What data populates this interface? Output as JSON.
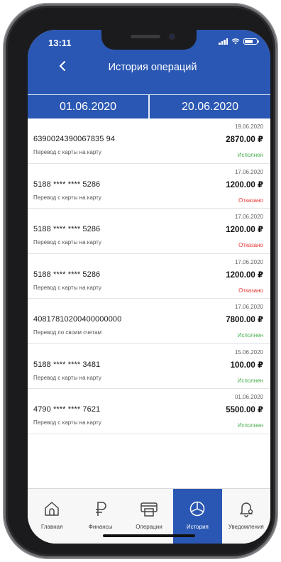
{
  "status_bar": {
    "time": "13:11"
  },
  "header": {
    "title": "История операций",
    "back_icon": "chevron-left-icon"
  },
  "period": {
    "from": "01.06.2020",
    "to": "20.06.2020"
  },
  "colors": {
    "primary": "#2a57b3",
    "success": "#4caf50",
    "declined": "#e53935"
  },
  "operations": [
    {
      "account": "6390024390067835 94",
      "description": "Перевод с карты на карту",
      "date": "19.06.2020",
      "amount": "2870.00 ₽",
      "status": "Исполнен",
      "status_kind": "success"
    },
    {
      "account": "5188 **** **** 5286",
      "description": "Перевод с карты на карту",
      "date": "17.06.2020",
      "amount": "1200.00 ₽",
      "status": "Отказано",
      "status_kind": "declined"
    },
    {
      "account": "5188 **** **** 5286",
      "description": "Перевод с карты на карту",
      "date": "17.06.2020",
      "amount": "1200.00 ₽",
      "status": "Отказано",
      "status_kind": "declined"
    },
    {
      "account": "5188 **** **** 5286",
      "description": "Перевод с карты на карту",
      "date": "17.06.2020",
      "amount": "1200.00 ₽",
      "status": "Отказано",
      "status_kind": "declined"
    },
    {
      "account": "40817810200400000000",
      "description": "Перевод по своим счетам",
      "date": "17.06.2020",
      "amount": "7800.00 ₽",
      "status": "Исполнен",
      "status_kind": "success"
    },
    {
      "account": "5188 **** **** 3481",
      "description": "Перевод с карты на карту",
      "date": "15.06.2020",
      "amount": "100.00 ₽",
      "status": "Исполнен",
      "status_kind": "success"
    },
    {
      "account": "4790 **** **** 7621",
      "description": "Перевод с карты на карту",
      "date": "01.06.2020",
      "amount": "5500.00 ₽",
      "status": "Исполнен",
      "status_kind": "success"
    }
  ],
  "tabs": [
    {
      "label": "Главная",
      "icon": "home-icon",
      "active": false
    },
    {
      "label": "Финансы",
      "icon": "ruble-icon",
      "active": false
    },
    {
      "label": "Операции",
      "icon": "printer-icon",
      "active": false
    },
    {
      "label": "История",
      "icon": "pie-chart-icon",
      "active": true
    },
    {
      "label": "Уведомления",
      "icon": "bell-icon",
      "active": false
    }
  ]
}
